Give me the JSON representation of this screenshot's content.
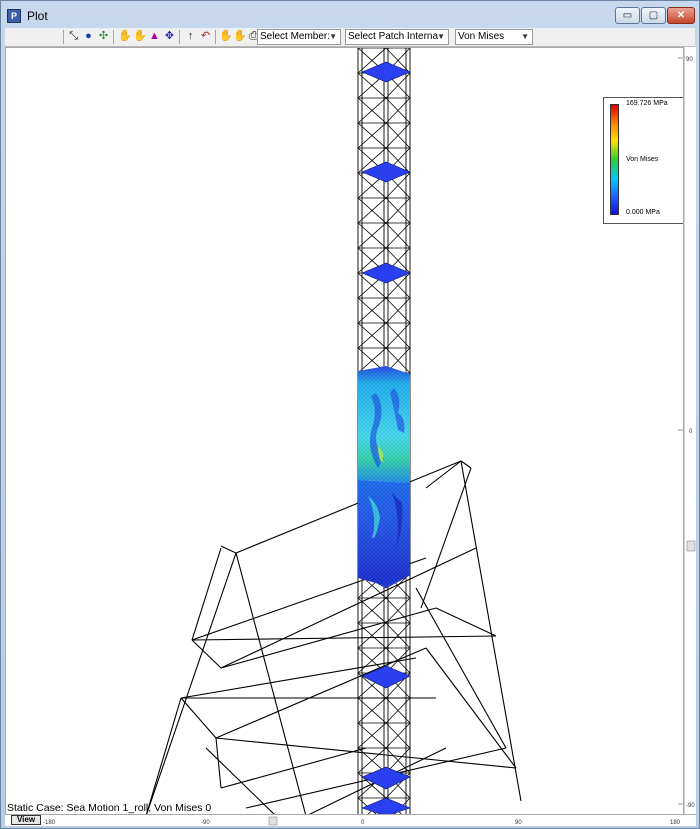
{
  "window": {
    "title": "Plot",
    "app_icon": "plot-app-icon",
    "controls": {
      "minimize": "▭",
      "maximize": "▢",
      "close": "✕"
    }
  },
  "toolbar": {
    "dropdowns": [
      {
        "label": "Select Member:",
        "arrow": "▼"
      },
      {
        "label": "Select Patch Interna",
        "arrow": "▼"
      },
      {
        "label": "Von Mises",
        "arrow": "▼"
      }
    ]
  },
  "legend": {
    "max": "169.726 MPa",
    "label": "Von Mises",
    "min": "0.000 MPa"
  },
  "axes": {
    "x_ticks": [
      "-180",
      "-90",
      "0",
      "90",
      "180"
    ],
    "y_ticks": [
      "90",
      "0",
      "-90"
    ]
  },
  "status": "Static Case: Sea Motion 1_roll, Von Mises 0",
  "view_tab": "View",
  "colors": {
    "structure": "#000000",
    "low_stress": "#1a3dd6",
    "mid_stress": "#1fb9e6",
    "high_stress": "#7ee04a"
  }
}
